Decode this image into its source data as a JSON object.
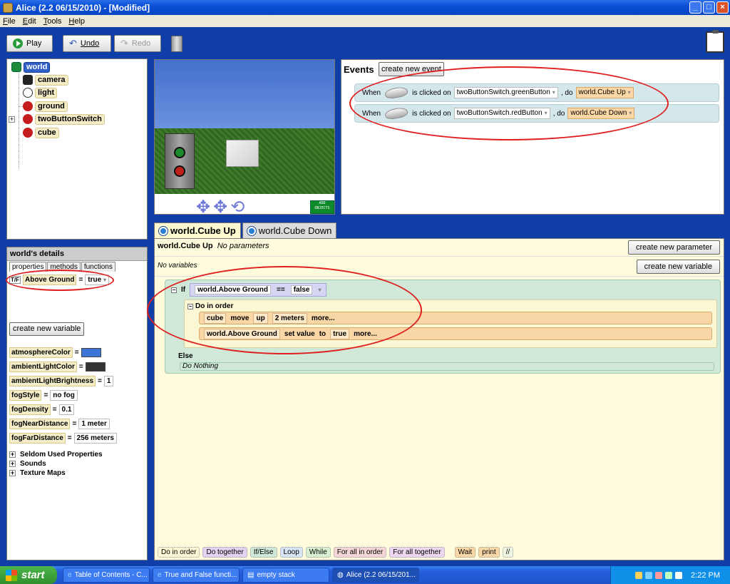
{
  "window": {
    "title": "Alice (2.2  06/15/2010) - [Modified]"
  },
  "menu": [
    "File",
    "Edit",
    "Tools",
    "Help"
  ],
  "toolbar": {
    "play": "Play",
    "undo": "Undo",
    "redo": "Redo"
  },
  "object_tree": [
    "world",
    "camera",
    "light",
    "ground",
    "twoButtonSwitch",
    "cube"
  ],
  "viewport": {
    "add_objects": "ADD OBJECTS"
  },
  "events": {
    "title": "Events",
    "create_new_event": "create new event",
    "rows": [
      {
        "when": "When",
        "clicked": "is clicked on",
        "target": "twoButtonSwitch.greenButton",
        "do": ", do",
        "method": "world.Cube Up"
      },
      {
        "when": "When",
        "clicked": "is clicked on",
        "target": "twoButtonSwitch.redButton",
        "do": ", do",
        "method": "world.Cube Down"
      }
    ]
  },
  "details": {
    "header": "world's details",
    "tabs": [
      "properties",
      "methods",
      "functions"
    ],
    "variable": {
      "type": "T/F",
      "name": "Above Ground",
      "eq": "=",
      "value": "true"
    },
    "create_new_variable": "create new variable",
    "props": [
      {
        "name": "atmosphereColor",
        "eq": "=",
        "value": ""
      },
      {
        "name": "ambientLightColor",
        "eq": "=",
        "value": ""
      },
      {
        "name": "ambientLightBrightness",
        "eq": "=",
        "value": "1"
      },
      {
        "name": "fogStyle",
        "eq": "=",
        "value": "no fog"
      },
      {
        "name": "fogDensity",
        "eq": "=",
        "value": "0.1"
      },
      {
        "name": "fogNearDistance",
        "eq": "=",
        "value": "1 meter"
      },
      {
        "name": "fogFarDistance",
        "eq": "=",
        "value": "256 meters"
      }
    ],
    "sections": [
      "Seldom Used Properties",
      "Sounds",
      "Texture Maps"
    ],
    "colors": {
      "atmosphere": "#3d74d6",
      "ambient": "#333333"
    }
  },
  "editor": {
    "tabs": [
      "world.Cube Up",
      "world.Cube Down"
    ],
    "method_name": "world.Cube Up",
    "no_params": "No parameters",
    "no_vars": "No variables",
    "create_new_parameter": "create new parameter",
    "create_new_variable": "create new variable",
    "if_label": "If",
    "condition": {
      "left": "world.Above Ground",
      "op": "==",
      "right": "false"
    },
    "do_in_order": "Do in order",
    "stmt1": {
      "obj": "cube",
      "verb": "move",
      "dir": "up",
      "amount": "2 meters",
      "more": "more..."
    },
    "stmt2": {
      "obj": "world.Above Ground",
      "verb": "set value",
      "to": "to",
      "value": "true",
      "more": "more..."
    },
    "else": "Else",
    "do_nothing": "Do Nothing",
    "palette": [
      "Do in order",
      "Do together",
      "If/Else",
      "Loop",
      "While",
      "For all in order",
      "For all together",
      "Wait",
      "print",
      "//"
    ]
  },
  "taskbar": {
    "start": "start",
    "items": [
      "Table of Contents - C...",
      "True and False functi...",
      "empty stack",
      "Alice (2.2  06/15/201..."
    ],
    "clock": "2:22 PM"
  }
}
